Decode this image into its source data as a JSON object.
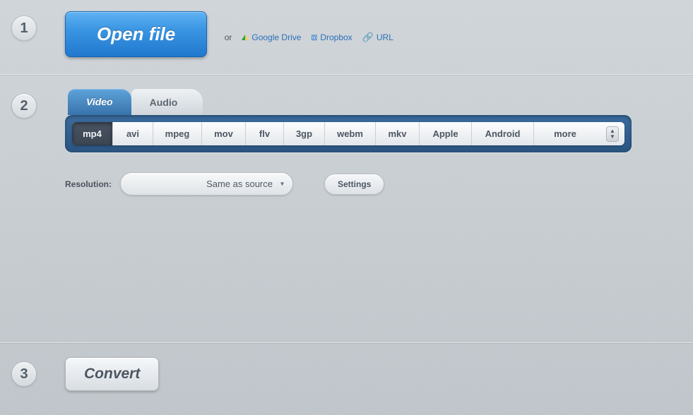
{
  "step1": {
    "number": "1",
    "open_file_label": "Open file",
    "or_text": "or",
    "google_drive_label": "Google Drive",
    "dropbox_label": "Dropbox",
    "url_label": "URL"
  },
  "step2": {
    "number": "2",
    "tabs": {
      "video": "Video",
      "audio": "Audio"
    },
    "formats": [
      "mp4",
      "avi",
      "mpeg",
      "mov",
      "flv",
      "3gp",
      "webm",
      "mkv",
      "Apple",
      "Android",
      "more"
    ],
    "active_format_index": 0,
    "resolution_label": "Resolution:",
    "resolution_value": "Same as source",
    "settings_label": "Settings"
  },
  "step3": {
    "number": "3",
    "convert_label": "Convert"
  }
}
